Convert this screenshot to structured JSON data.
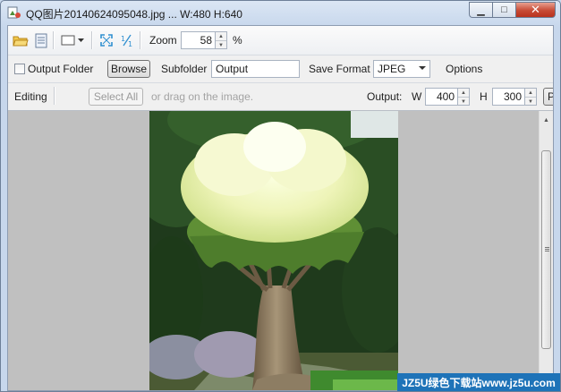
{
  "window": {
    "title": "QQ图片20140624095048.jpg ... W:480 H:640",
    "controls": {
      "minimize": "▁",
      "maximize": "□",
      "close": "✕"
    }
  },
  "toolbar": {
    "icons": [
      "open-folder-icon",
      "document-icon",
      "frame-dropdown-icon",
      "fit-to-window-icon",
      "actual-size-icon"
    ],
    "zoom_label": "Zoom",
    "zoom_value": "58",
    "zoom_unit": "%"
  },
  "options": {
    "output_folder_label": "Output Folder",
    "output_folder_checked": false,
    "browse_label": "Browse",
    "subfolder_label": "Subfolder",
    "subfolder_value": "Output",
    "save_format_label": "Save Format",
    "save_format_value": "JPEG",
    "options_label": "Options"
  },
  "editing": {
    "label": "Editing",
    "select_all_label": "Select All",
    "drag_hint": "or drag on the image.",
    "output_label": "Output:",
    "w_label": "W",
    "w_value": "400",
    "h_label": "H",
    "h_value": "300",
    "preview_button_label": "Pr"
  },
  "watermark": {
    "text": "JZ5U绿色下载站www.jz5u.com"
  },
  "colors": {
    "canvas_bg": "#c0c0c0",
    "watermark_bg": "#1e73b8",
    "close_button": "#c74a34"
  }
}
